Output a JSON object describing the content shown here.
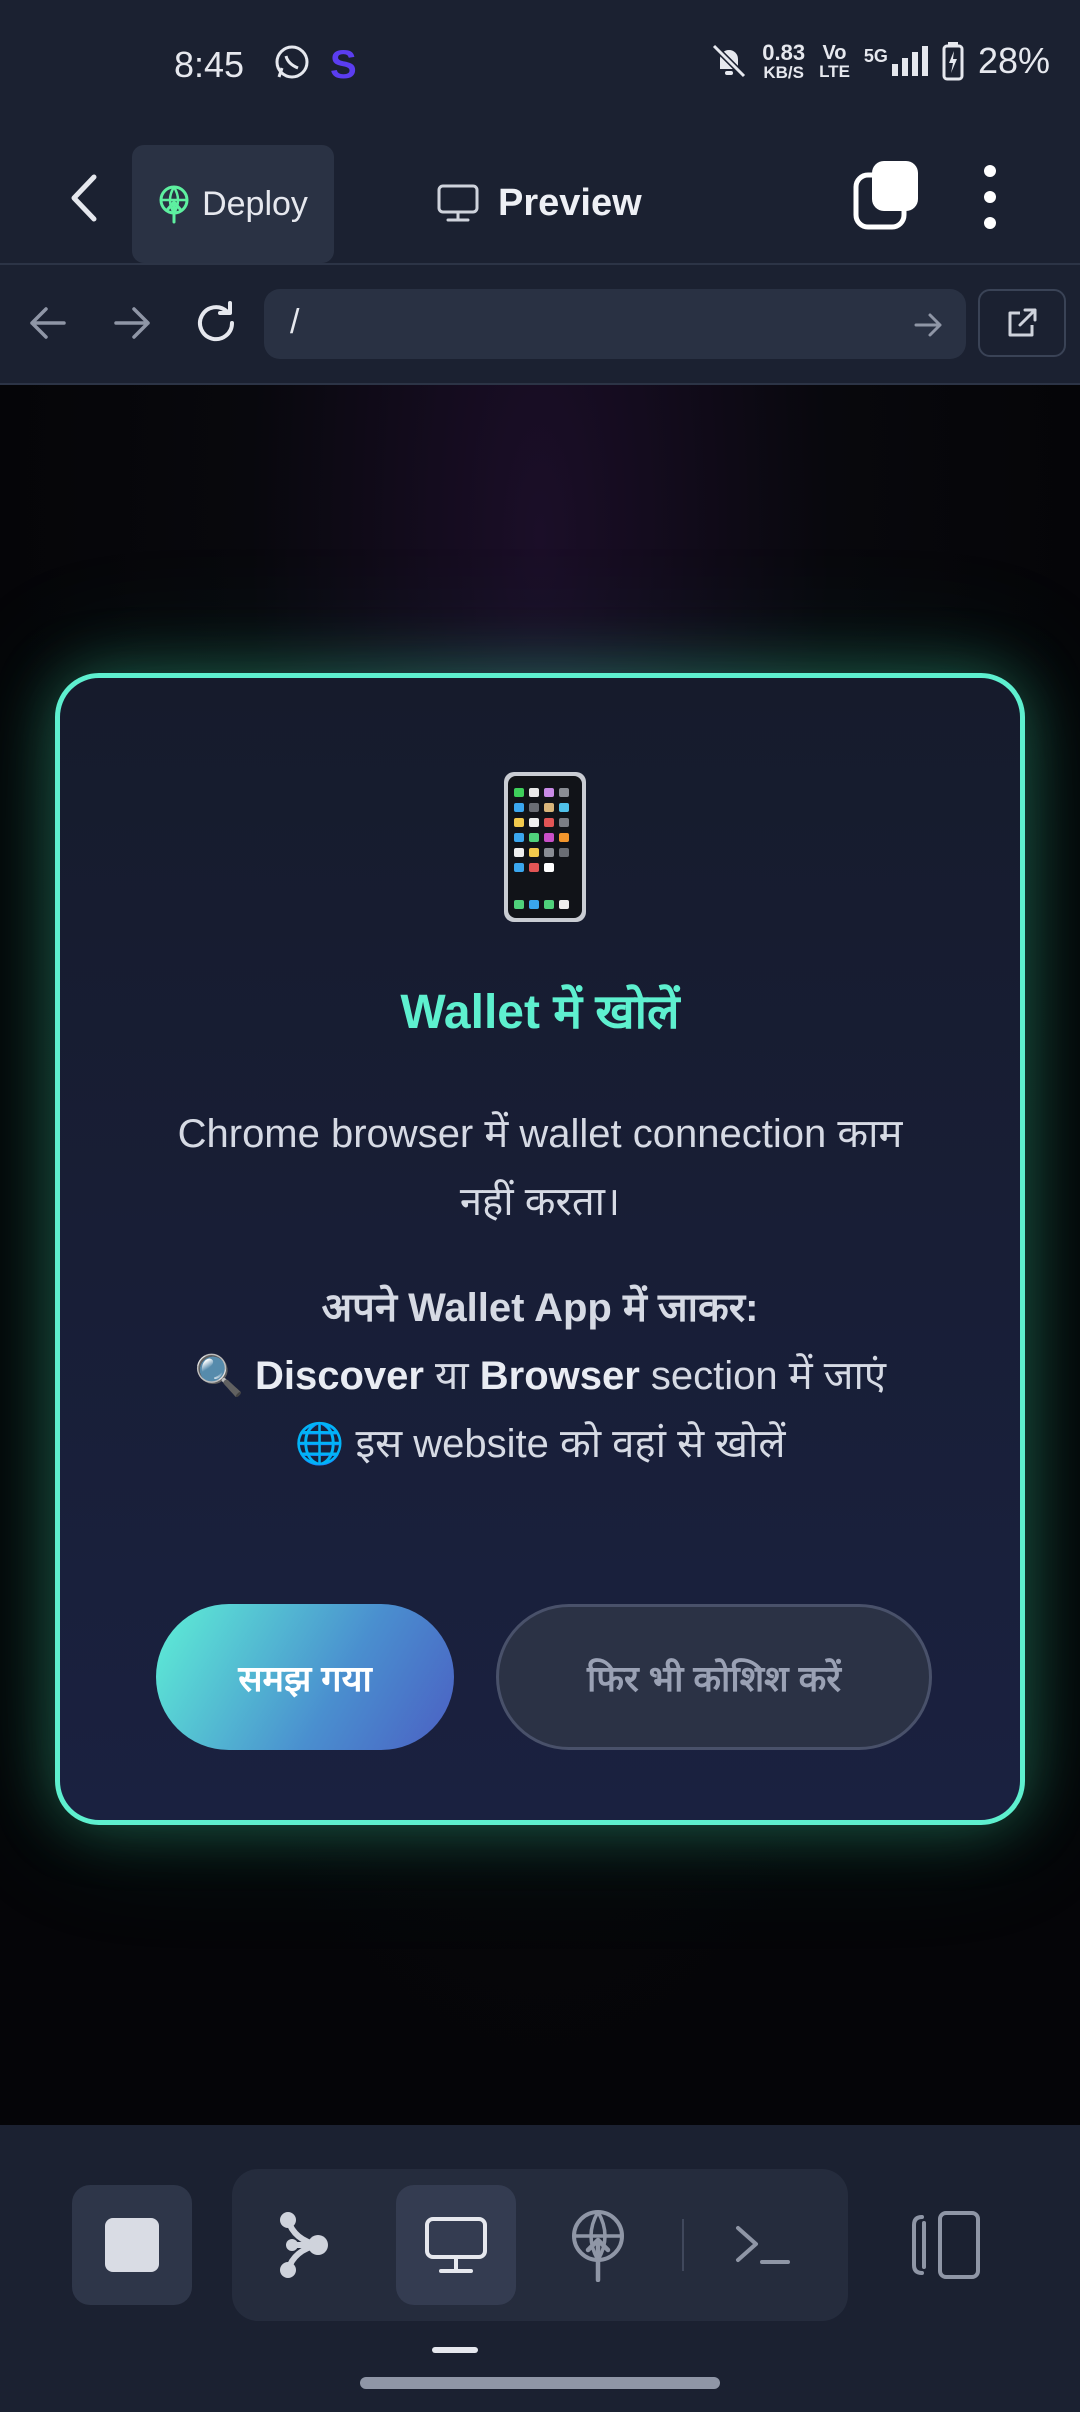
{
  "status_bar": {
    "time": "8:45",
    "icons": [
      "whatsapp-icon",
      "s-app-icon",
      "mute-icon",
      "volte-icon",
      "5g-signal-icon",
      "battery-charging-icon"
    ],
    "net_speed_value": "0.83",
    "net_speed_unit": "KB/S",
    "volte_top": "Vo",
    "volte_bottom": "LTE",
    "network": "5G",
    "battery": "28%"
  },
  "toolbar": {
    "deploy_label": "Deploy",
    "preview_label": "Preview",
    "accent": "#5ef0a0"
  },
  "browser": {
    "url": "/"
  },
  "modal": {
    "icon": "mobile-phone-emoji",
    "title": "Wallet में खोलें",
    "description": "Chrome browser में wallet connection काम नहीं करता।",
    "instructions_heading": "अपने Wallet App में जाकर:",
    "instruction_1": {
      "icon": "🔍",
      "bold_1": "Discover",
      "text_1": " या ",
      "bold_2": "Browser",
      "text_2": " section में जाएं"
    },
    "instruction_2": {
      "icon": "🌐",
      "text": " इस website को वहां से खोलें"
    },
    "primary_button": "समझ गया",
    "secondary_button": "फिर भी कोशिश करें",
    "accent": "#5ef0cf"
  },
  "bottom_bar": {
    "items": [
      "stop-icon",
      "graph-icon",
      "monitor-icon",
      "deploy-icon",
      "terminal-icon",
      "side-panel-icon"
    ],
    "active": "monitor-icon"
  }
}
